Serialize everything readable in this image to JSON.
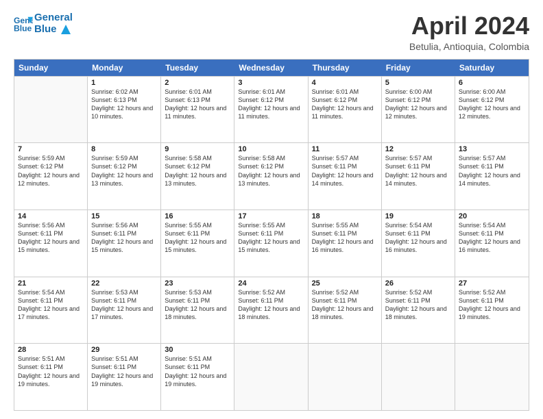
{
  "header": {
    "logo_line1": "General",
    "logo_line2": "Blue",
    "month_title": "April 2024",
    "location": "Betulia, Antioquia, Colombia"
  },
  "weekdays": [
    "Sunday",
    "Monday",
    "Tuesday",
    "Wednesday",
    "Thursday",
    "Friday",
    "Saturday"
  ],
  "weeks": [
    [
      {
        "day": "",
        "empty": true
      },
      {
        "day": "1",
        "sunrise": "6:02 AM",
        "sunset": "6:13 PM",
        "daylight": "12 hours and 10 minutes."
      },
      {
        "day": "2",
        "sunrise": "6:01 AM",
        "sunset": "6:13 PM",
        "daylight": "12 hours and 11 minutes."
      },
      {
        "day": "3",
        "sunrise": "6:01 AM",
        "sunset": "6:12 PM",
        "daylight": "12 hours and 11 minutes."
      },
      {
        "day": "4",
        "sunrise": "6:01 AM",
        "sunset": "6:12 PM",
        "daylight": "12 hours and 11 minutes."
      },
      {
        "day": "5",
        "sunrise": "6:00 AM",
        "sunset": "6:12 PM",
        "daylight": "12 hours and 12 minutes."
      },
      {
        "day": "6",
        "sunrise": "6:00 AM",
        "sunset": "6:12 PM",
        "daylight": "12 hours and 12 minutes."
      }
    ],
    [
      {
        "day": "7",
        "sunrise": "5:59 AM",
        "sunset": "6:12 PM",
        "daylight": "12 hours and 12 minutes."
      },
      {
        "day": "8",
        "sunrise": "5:59 AM",
        "sunset": "6:12 PM",
        "daylight": "12 hours and 13 minutes."
      },
      {
        "day": "9",
        "sunrise": "5:58 AM",
        "sunset": "6:12 PM",
        "daylight": "12 hours and 13 minutes."
      },
      {
        "day": "10",
        "sunrise": "5:58 AM",
        "sunset": "6:12 PM",
        "daylight": "12 hours and 13 minutes."
      },
      {
        "day": "11",
        "sunrise": "5:57 AM",
        "sunset": "6:11 PM",
        "daylight": "12 hours and 14 minutes."
      },
      {
        "day": "12",
        "sunrise": "5:57 AM",
        "sunset": "6:11 PM",
        "daylight": "12 hours and 14 minutes."
      },
      {
        "day": "13",
        "sunrise": "5:57 AM",
        "sunset": "6:11 PM",
        "daylight": "12 hours and 14 minutes."
      }
    ],
    [
      {
        "day": "14",
        "sunrise": "5:56 AM",
        "sunset": "6:11 PM",
        "daylight": "12 hours and 15 minutes."
      },
      {
        "day": "15",
        "sunrise": "5:56 AM",
        "sunset": "6:11 PM",
        "daylight": "12 hours and 15 minutes."
      },
      {
        "day": "16",
        "sunrise": "5:55 AM",
        "sunset": "6:11 PM",
        "daylight": "12 hours and 15 minutes."
      },
      {
        "day": "17",
        "sunrise": "5:55 AM",
        "sunset": "6:11 PM",
        "daylight": "12 hours and 15 minutes."
      },
      {
        "day": "18",
        "sunrise": "5:55 AM",
        "sunset": "6:11 PM",
        "daylight": "12 hours and 16 minutes."
      },
      {
        "day": "19",
        "sunrise": "5:54 AM",
        "sunset": "6:11 PM",
        "daylight": "12 hours and 16 minutes."
      },
      {
        "day": "20",
        "sunrise": "5:54 AM",
        "sunset": "6:11 PM",
        "daylight": "12 hours and 16 minutes."
      }
    ],
    [
      {
        "day": "21",
        "sunrise": "5:54 AM",
        "sunset": "6:11 PM",
        "daylight": "12 hours and 17 minutes."
      },
      {
        "day": "22",
        "sunrise": "5:53 AM",
        "sunset": "6:11 PM",
        "daylight": "12 hours and 17 minutes."
      },
      {
        "day": "23",
        "sunrise": "5:53 AM",
        "sunset": "6:11 PM",
        "daylight": "12 hours and 18 minutes."
      },
      {
        "day": "24",
        "sunrise": "5:52 AM",
        "sunset": "6:11 PM",
        "daylight": "12 hours and 18 minutes."
      },
      {
        "day": "25",
        "sunrise": "5:52 AM",
        "sunset": "6:11 PM",
        "daylight": "12 hours and 18 minutes."
      },
      {
        "day": "26",
        "sunrise": "5:52 AM",
        "sunset": "6:11 PM",
        "daylight": "12 hours and 18 minutes."
      },
      {
        "day": "27",
        "sunrise": "5:52 AM",
        "sunset": "6:11 PM",
        "daylight": "12 hours and 19 minutes."
      }
    ],
    [
      {
        "day": "28",
        "sunrise": "5:51 AM",
        "sunset": "6:11 PM",
        "daylight": "12 hours and 19 minutes."
      },
      {
        "day": "29",
        "sunrise": "5:51 AM",
        "sunset": "6:11 PM",
        "daylight": "12 hours and 19 minutes."
      },
      {
        "day": "30",
        "sunrise": "5:51 AM",
        "sunset": "6:11 PM",
        "daylight": "12 hours and 19 minutes."
      },
      {
        "day": "",
        "empty": true
      },
      {
        "day": "",
        "empty": true
      },
      {
        "day": "",
        "empty": true
      },
      {
        "day": "",
        "empty": true
      }
    ]
  ]
}
